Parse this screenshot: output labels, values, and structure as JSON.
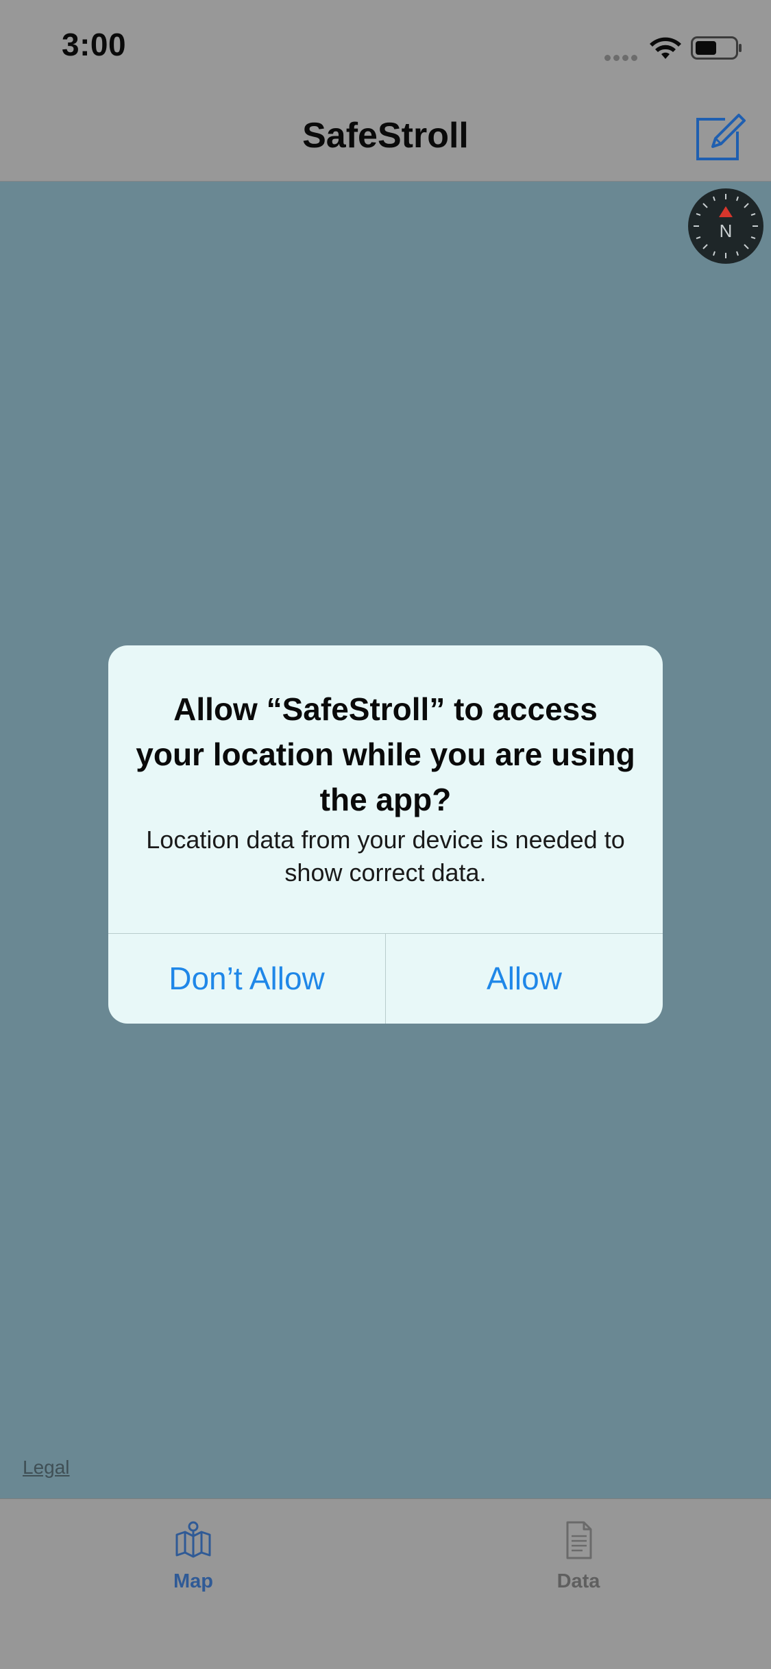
{
  "status_bar": {
    "time": "3:00"
  },
  "nav_bar": {
    "title": "SafeStroll",
    "compose_icon": "compose-icon"
  },
  "map": {
    "compass_label": "N",
    "legal_label": "Legal"
  },
  "alert": {
    "title": "Allow “SafeStroll” to access your location while you are using the app?",
    "message": "Location data from your device is needed to show correct data.",
    "dont_allow_label": "Don’t Allow",
    "allow_label": "Allow"
  },
  "tab_bar": {
    "tabs": [
      {
        "label": "Map",
        "icon": "map-icon",
        "selected": true
      },
      {
        "label": "Data",
        "icon": "document-icon",
        "selected": false
      }
    ]
  },
  "colors": {
    "accent": "#1f87e8",
    "selected_tab": "#2f5a96",
    "map_background": "#6a8893"
  }
}
